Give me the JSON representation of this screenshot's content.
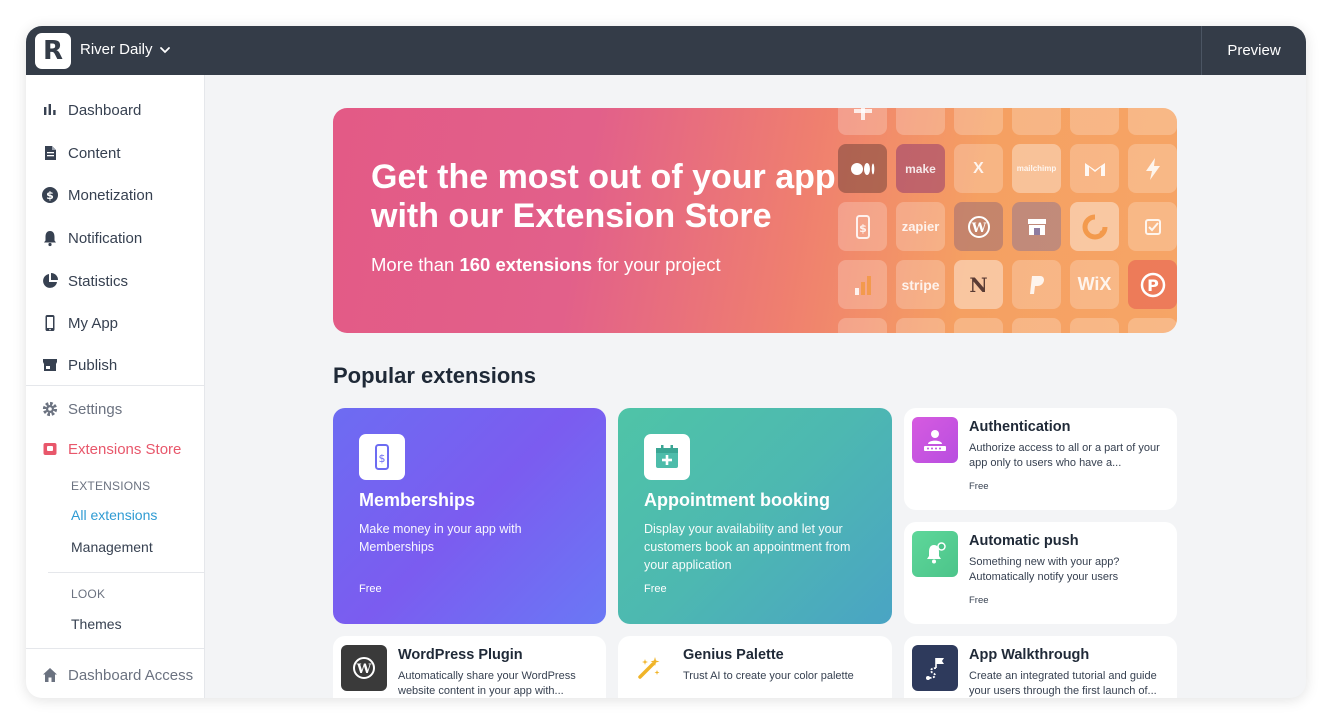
{
  "topbar": {
    "logo_letter": "R",
    "app_name": "River Daily",
    "preview_label": "Preview"
  },
  "sidebar": {
    "items": [
      {
        "label": "Dashboard",
        "icon": "bar-chart-icon"
      },
      {
        "label": "Content",
        "icon": "document-icon"
      },
      {
        "label": "Monetization",
        "icon": "dollar-coin-icon"
      },
      {
        "label": "Notification",
        "icon": "bell-icon"
      },
      {
        "label": "Statistics",
        "icon": "pie-chart-icon"
      },
      {
        "label": "My App",
        "icon": "phone-icon"
      },
      {
        "label": "Publish",
        "icon": "store-icon"
      }
    ],
    "settings_label": "Settings",
    "extensions_store_label": "Extensions Store",
    "extensions_section": "EXTENSIONS",
    "all_extensions": "All extensions",
    "management": "Management",
    "look_section": "LOOK",
    "themes": "Themes",
    "dashboard_access": "Dashboard Access",
    "active_color": "#e8576b",
    "link_color": "#2f9bd3"
  },
  "banner": {
    "title": "Get the most out of your app with our Extension Store",
    "subtitle_pre": "More than ",
    "subtitle_bold": "160 extensions",
    "subtitle_post": " for your project",
    "tiles": {
      "make": "make",
      "zapier": "zapier",
      "stripe": "stripe",
      "wix": "WiX",
      "excel": "X",
      "notion": "N",
      "mailchimp": "mailchimp"
    }
  },
  "popular": {
    "title": "Popular extensions",
    "cards": [
      {
        "title": "Memberships",
        "desc": "Make money in your app with Memberships",
        "price": "Free",
        "icon": "phone-dollar-icon"
      },
      {
        "title": "Appointment booking",
        "desc": "Display your availability and let your customers book an appointment from your application",
        "price": "Free",
        "icon": "calendar-plus-icon"
      },
      {
        "title": "Authentication",
        "desc": "Authorize access to all or a part of your app only to users who have a...",
        "price": "Free",
        "icon": "user-password-icon"
      },
      {
        "title": "Automatic push",
        "desc": "Something new with your app? Automatically notify your users",
        "price": "Free",
        "icon": "bell-clock-icon"
      },
      {
        "title": "WordPress Plugin",
        "desc": "Automatically share your WordPress website content in your app with...",
        "icon": "wordpress-icon"
      },
      {
        "title": "Genius Palette",
        "desc": "Trust AI to create your color palette",
        "icon": "magic-wand-icon"
      },
      {
        "title": "App Walkthrough",
        "desc": "Create an integrated tutorial and guide your users through the first launch of...",
        "icon": "flag-path-icon"
      }
    ]
  }
}
